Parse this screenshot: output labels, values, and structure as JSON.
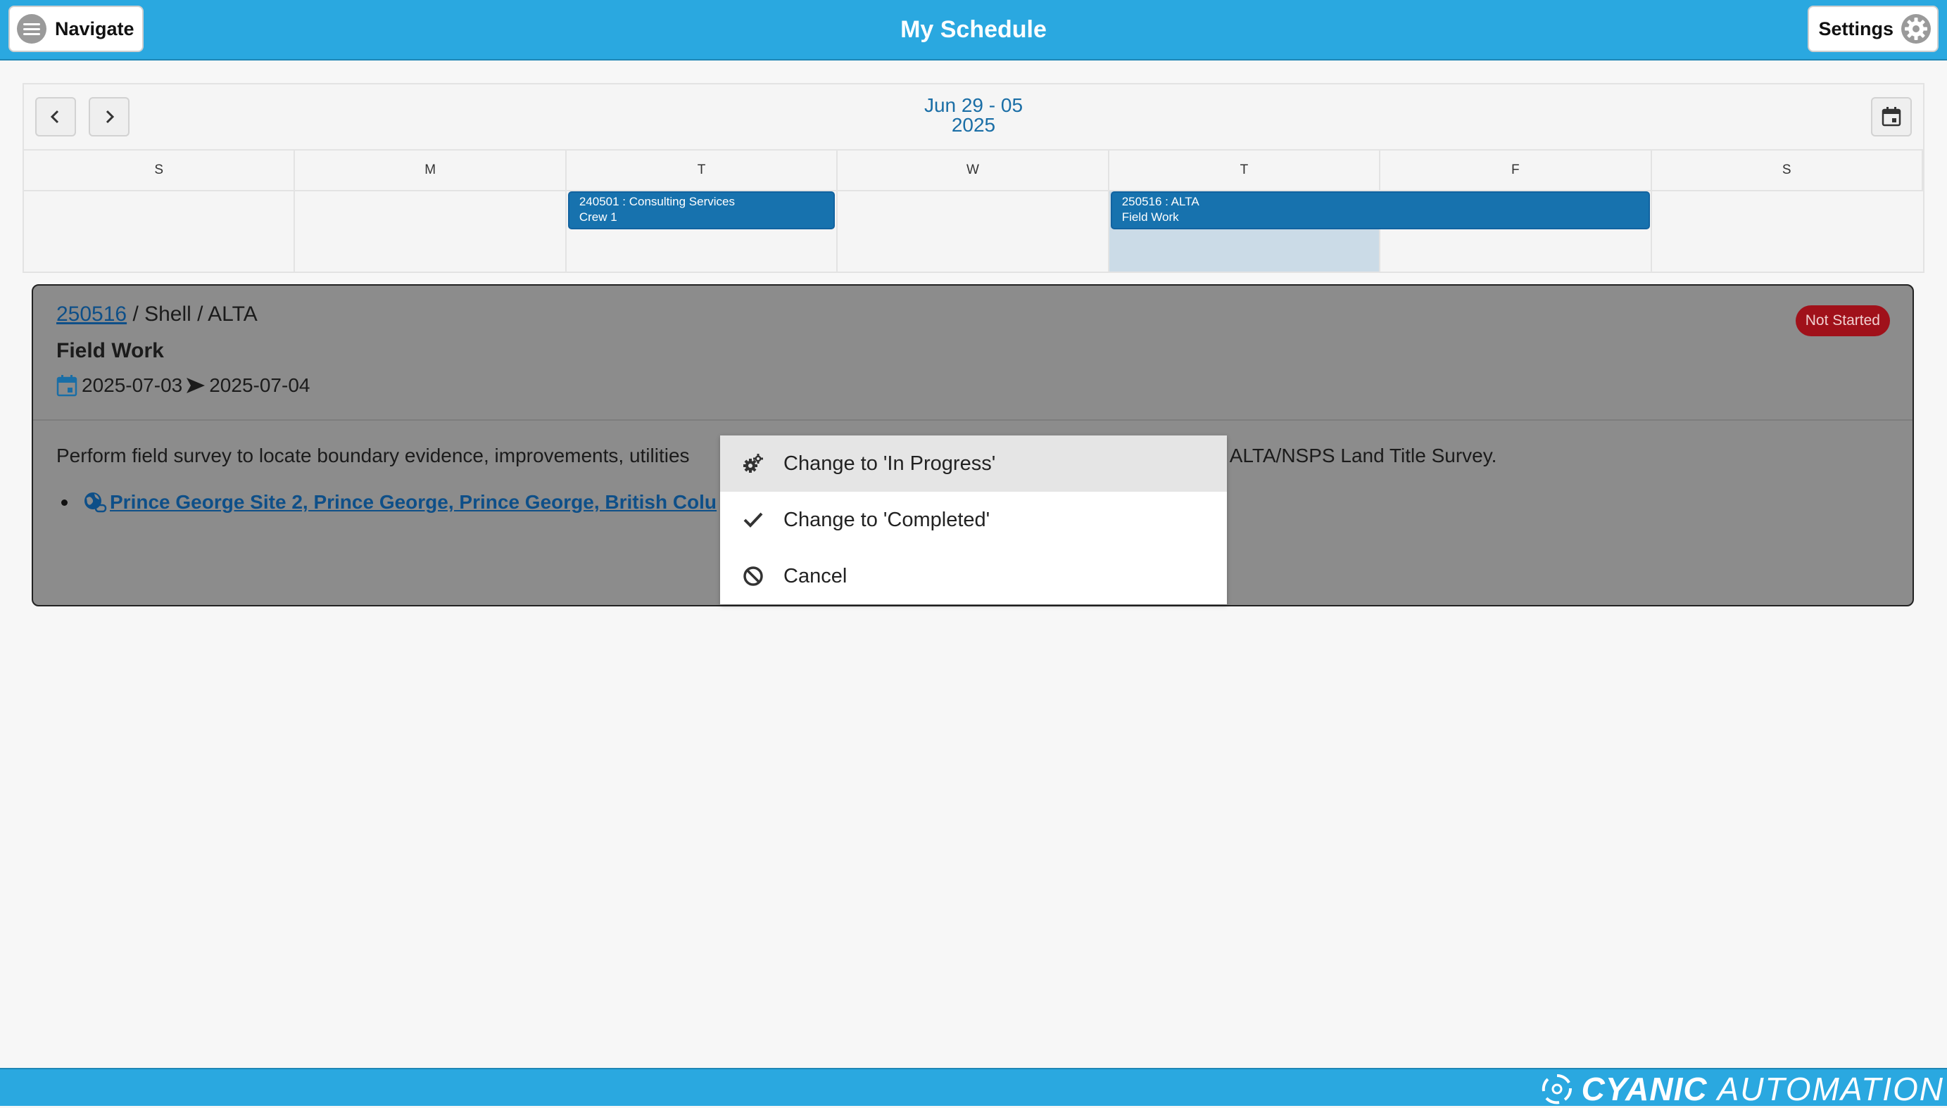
{
  "header": {
    "nav_label": "Navigate",
    "title": "My Schedule",
    "settings_label": "Settings"
  },
  "calendar": {
    "range_line1": "Jun 29 - 05",
    "range_line2": "2025",
    "weekdays": [
      "S",
      "M",
      "T",
      "W",
      "T",
      "F",
      "S"
    ],
    "events": [
      {
        "line1": "240501 : Consulting Services",
        "line2": "Crew 1"
      },
      {
        "line1": "250516 : ALTA",
        "line2": "Field Work"
      }
    ]
  },
  "detail": {
    "project_number": "250516",
    "path_rest": " / Shell / ALTA",
    "task_title": "Field Work",
    "start_date": "2025-07-03",
    "end_date": "2025-07-04",
    "status": "Not Started",
    "description_start": "Perform field survey to locate boundary evidence, improvements, utilities",
    "description_end": "the ALTA/NSPS Land Title Survey.",
    "location": "Prince George Site 2, Prince George, Prince George, British Colu"
  },
  "context_menu": {
    "items": [
      {
        "label": "Change to 'In Progress'",
        "icon": "gears-icon"
      },
      {
        "label": "Change to 'Completed'",
        "icon": "check-icon"
      },
      {
        "label": "Cancel",
        "icon": "ban-icon"
      }
    ]
  },
  "footer": {
    "brand_bold": "CYANIC",
    "brand_light": "AUTOMATION"
  },
  "colors": {
    "header_blue": "#2aa8e0",
    "event_blue": "#1772ae",
    "status_red": "#a0111a",
    "today_highlight": "#cbdbe7"
  }
}
